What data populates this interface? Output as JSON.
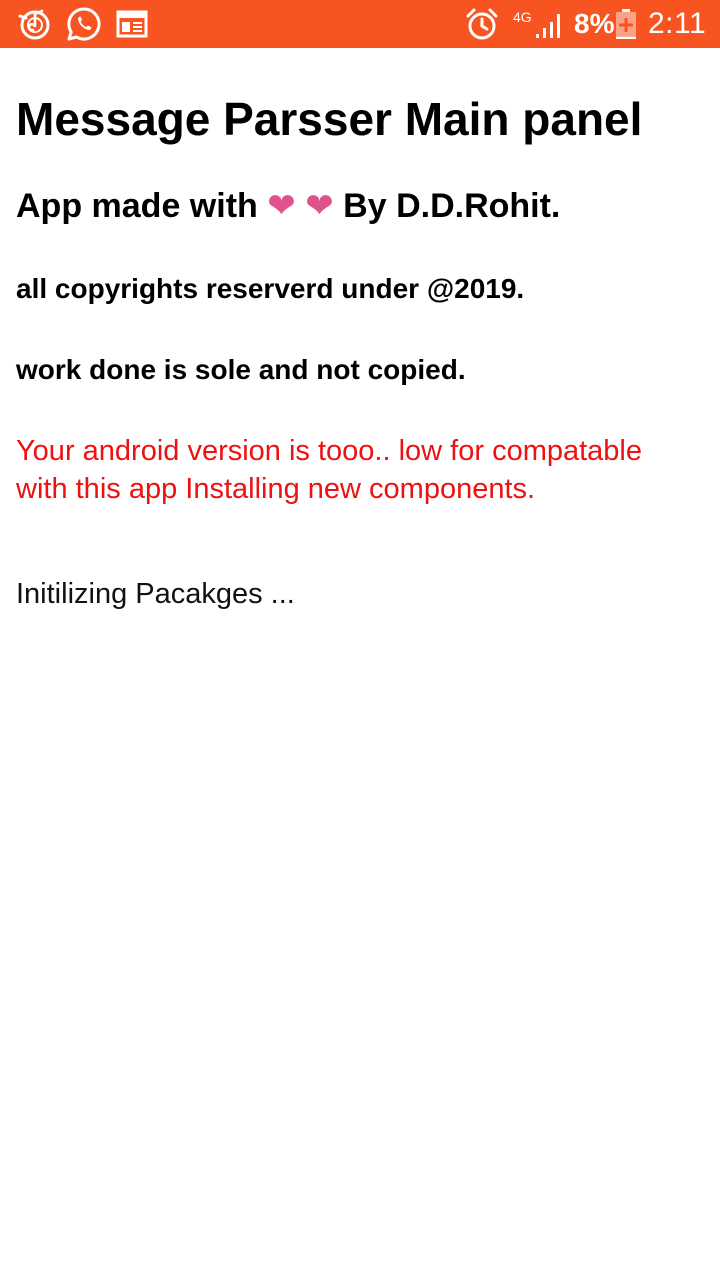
{
  "status_bar": {
    "background": "#f75422",
    "left_icons": [
      "music-app-icon",
      "whatsapp-icon",
      "news-app-icon"
    ],
    "alarm_icon": "alarm-clock-icon",
    "network": "4G",
    "battery": "8%",
    "battery_level": 0.08,
    "time": "2:11"
  },
  "main": {
    "title": "Message Parsser Main panel",
    "credit_prefix": "App made with",
    "heart_1": "❤",
    "heart_2": "❤",
    "credit_suffix": "By D.D.Rohit.",
    "copyright": "all copyrights reserverd under @2019.",
    "originality": "work done is sole and not copied.",
    "warning": "Your android version is tooo.. low for compatable with this app Installing new components.",
    "status": "Initilizing Pacakges ..."
  },
  "colors": {
    "accent": "#f75422",
    "heart": "#e0528b",
    "warning_text": "#ee1111"
  }
}
